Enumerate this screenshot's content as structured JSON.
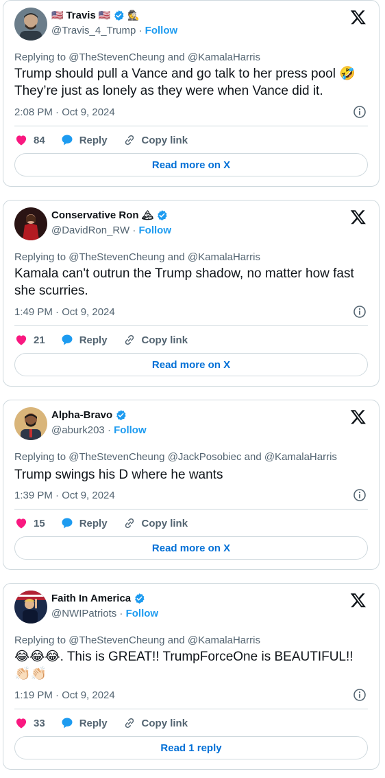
{
  "tweets": [
    {
      "name": "Travis",
      "name_prefix_emoji": "🇺🇸",
      "name_suffix_emoji": "🇺🇸",
      "extra_emoji": "🕵",
      "handle": "@Travis_4_Trump",
      "follow_label": "Follow",
      "replying": "Replying to @TheStevenCheung and @KamalaHarris",
      "text": "Trump should pull a Vance and go talk to her press pool 🤣 They’re just as lonely as they were when Vance did it.",
      "timestamp": "2:08 PM · Oct 9, 2024",
      "likes": "84",
      "reply_label": "Reply",
      "copy_label": "Copy link",
      "cta_label": "Read more on X"
    },
    {
      "name": "Conservative Ron",
      "name_suffix_emoji": "🏔",
      "handle": "@DavidRon_RW",
      "follow_label": "Follow",
      "replying": "Replying to @TheStevenCheung and @KamalaHarris",
      "text": "Kamala can't outrun the Trump shadow, no matter how fast she scurries.",
      "timestamp": "1:49 PM · Oct 9, 2024",
      "likes": "21",
      "reply_label": "Reply",
      "copy_label": "Copy link",
      "cta_label": "Read more on X"
    },
    {
      "name": "Alpha-Bravo",
      "handle": "@aburk203",
      "follow_label": "Follow",
      "replying": "Replying to @TheStevenCheung @JackPosobiec and @KamalaHarris",
      "text": "Trump swings his D where he wants",
      "timestamp": "1:39 PM · Oct 9, 2024",
      "likes": "15",
      "reply_label": "Reply",
      "copy_label": "Copy link",
      "cta_label": "Read more on X"
    },
    {
      "name": "Faith In America",
      "handle": "@NWIPatriots",
      "follow_label": "Follow",
      "replying": "Replying to @TheStevenCheung and @KamalaHarris",
      "text": "😂😂😂. This is GREAT!! TrumpForceOne is BEAUTIFUL!! 👏🏻👏🏻",
      "timestamp": "1:19 PM · Oct 9, 2024",
      "likes": "33",
      "reply_label": "Reply",
      "copy_label": "Copy link",
      "cta_label": "Read 1 reply"
    }
  ],
  "colors": {
    "like": "#f91880",
    "reply": "#1d9bf0",
    "verified": "#1d9bf0",
    "link": "#1d9bf0",
    "cta_text": "#006fd6",
    "muted": "#536471",
    "border": "#cfd9de"
  },
  "icons": [
    "verified-badge-icon",
    "x-logo-icon",
    "info-icon",
    "heart-icon",
    "reply-bubble-icon",
    "link-icon"
  ]
}
